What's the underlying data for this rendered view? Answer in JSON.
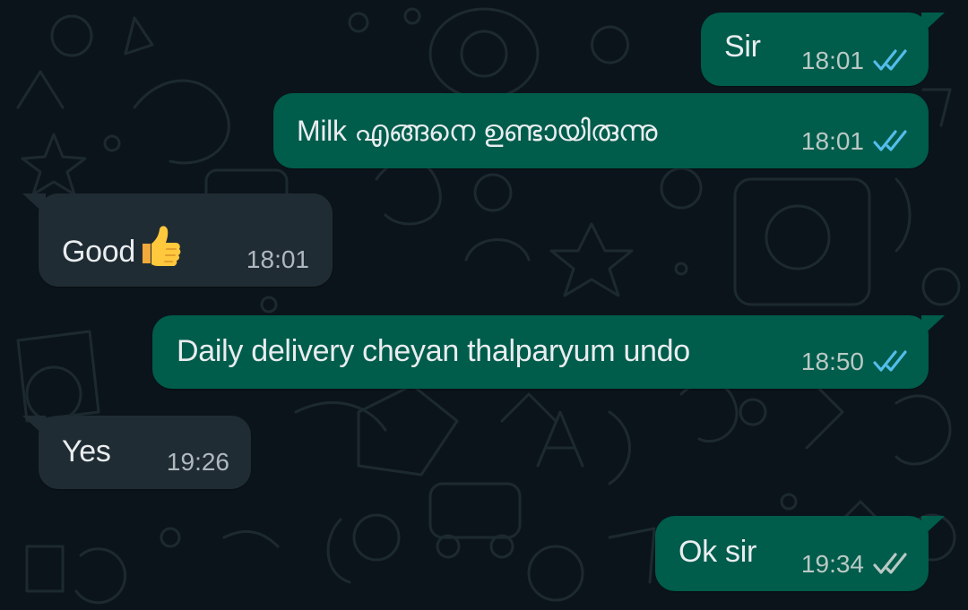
{
  "colors": {
    "background": "#0b141a",
    "outgoing_bubble": "#005c4b",
    "incoming_bubble": "#202c33",
    "read_ticks": "#53bdeb",
    "delivered_ticks": "#b9c9c4"
  },
  "messages": [
    {
      "direction": "outgoing",
      "text": "Sir",
      "time": "18:01",
      "status": "read"
    },
    {
      "direction": "outgoing",
      "text": "Milk എങ്ങനെ ഉണ്ടായിരുന്നു",
      "time": "18:01",
      "status": "read"
    },
    {
      "direction": "incoming",
      "text": "Good",
      "emoji": "thumbs-up",
      "time": "18:01"
    },
    {
      "direction": "outgoing",
      "text": "Daily delivery cheyan thalparyum undo",
      "time": "18:50",
      "status": "read"
    },
    {
      "direction": "incoming",
      "text": "Yes",
      "time": "19:26"
    },
    {
      "direction": "outgoing",
      "text": "Ok sir",
      "time": "19:34",
      "status": "delivered"
    }
  ]
}
